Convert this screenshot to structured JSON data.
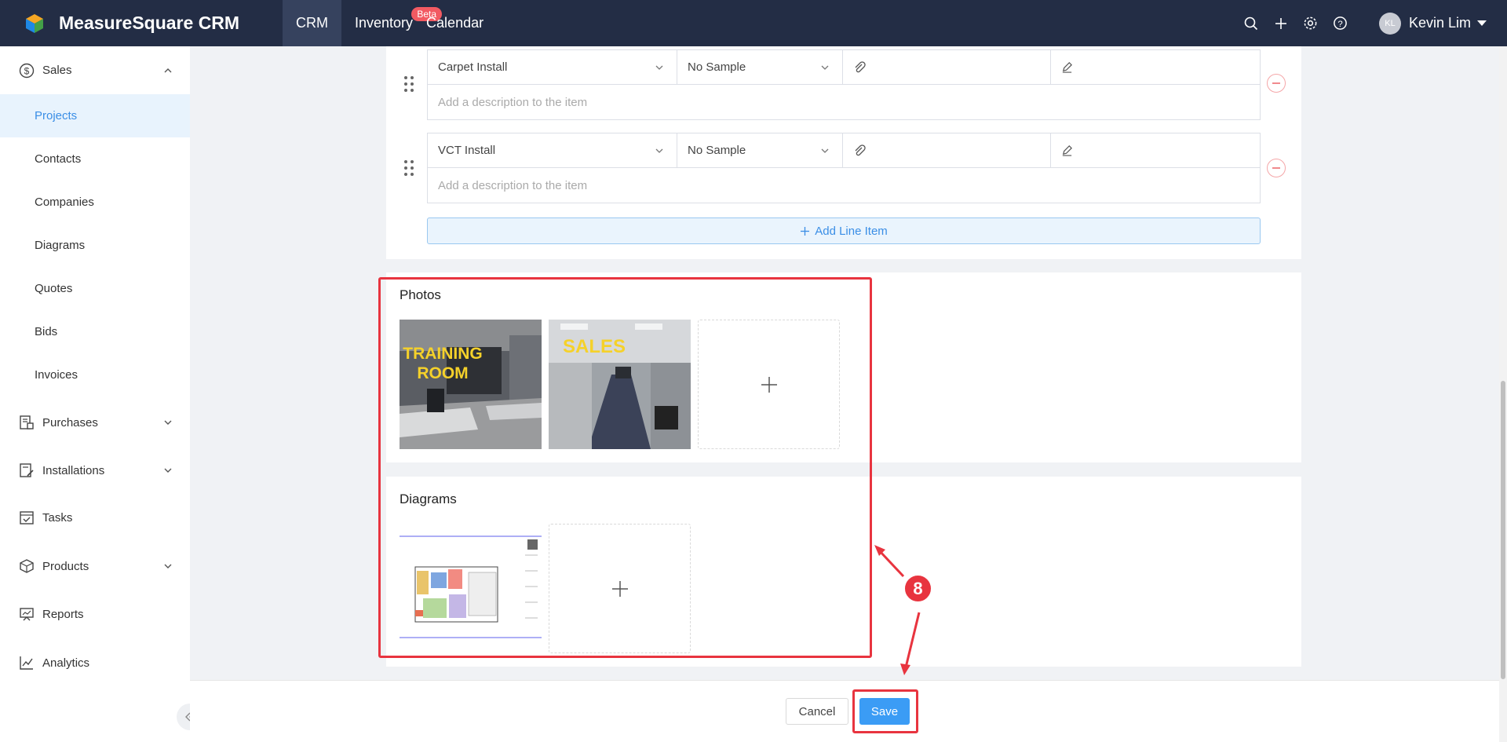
{
  "app": {
    "name": "MeasureSquare CRM"
  },
  "nav": [
    {
      "label": "CRM"
    },
    {
      "label": "Inventory",
      "badge": "Beta"
    },
    {
      "label": "Calendar"
    }
  ],
  "user": {
    "initials": "KL",
    "name": "Kevin Lim"
  },
  "sidebar": {
    "sales": "Sales",
    "sub": [
      "Projects",
      "Contacts",
      "Companies",
      "Diagrams",
      "Quotes",
      "Bids",
      "Invoices"
    ],
    "purchases": "Purchases",
    "installations": "Installations",
    "tasks": "Tasks",
    "products": "Products",
    "reports": "Reports",
    "analytics": "Analytics"
  },
  "line_items": [
    {
      "product": "Carpet Install",
      "sample": "No Sample",
      "description_placeholder": "Add a description to the item"
    },
    {
      "product": "VCT Install",
      "sample": "No Sample",
      "description_placeholder": "Add a description to the item"
    }
  ],
  "add_line_item": "Add Line Item",
  "photos": {
    "title": "Photos",
    "items": [
      {
        "caption": "TRAINING ROOM",
        "caption_line1": "TRAINING",
        "caption_line2": "ROOM"
      },
      {
        "caption": "SALES"
      }
    ]
  },
  "diagrams": {
    "title": "Diagrams"
  },
  "annotation": {
    "step": "8"
  },
  "footer": {
    "cancel": "Cancel",
    "save": "Save"
  },
  "colors": {
    "topbar": "#232d45",
    "accent": "#3b9cf5",
    "highlight": "#e8343f",
    "caption": "#f5d12a"
  }
}
